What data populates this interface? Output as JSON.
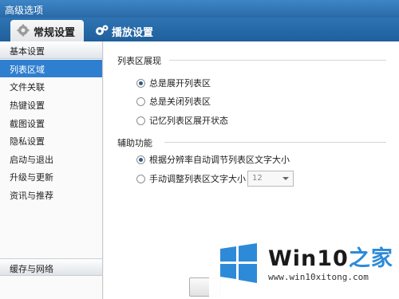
{
  "window": {
    "title": "高级选项"
  },
  "tabs": [
    {
      "label": "常规设置",
      "icon": "gear-icon"
    },
    {
      "label": "播放设置",
      "icon": "gears-icon"
    }
  ],
  "sidebar": {
    "items": [
      {
        "label": "基本设置"
      },
      {
        "label": "列表区域"
      },
      {
        "label": "文件关联"
      },
      {
        "label": "热键设置"
      },
      {
        "label": "截图设置"
      },
      {
        "label": "隐私设置"
      },
      {
        "label": "启动与退出"
      },
      {
        "label": "升级与更新"
      },
      {
        "label": "资讯与推荐"
      }
    ],
    "bottom_label": "缓存与网络"
  },
  "content": {
    "section1_title": "列表区展现",
    "options1": [
      {
        "label": "总是展开列表区",
        "checked": true
      },
      {
        "label": "总是关闭列表区",
        "checked": false
      },
      {
        "label": "记忆列表区展开状态",
        "checked": false
      }
    ],
    "section2_title": "辅助功能",
    "options2": [
      {
        "label": "根据分辨率自动调节列表区文字大小",
        "checked": true
      },
      {
        "label": "手动调整列表区文字大小",
        "checked": false
      }
    ],
    "font_size_select": "12"
  },
  "watermark": {
    "title_main": "Win10",
    "title_accent": "之家",
    "url": "www.win10xitong.com"
  },
  "colors": {
    "accent": "#2f7fd0",
    "titlebar": "#2a69a8",
    "logo_blue": "#2d8ad8"
  }
}
